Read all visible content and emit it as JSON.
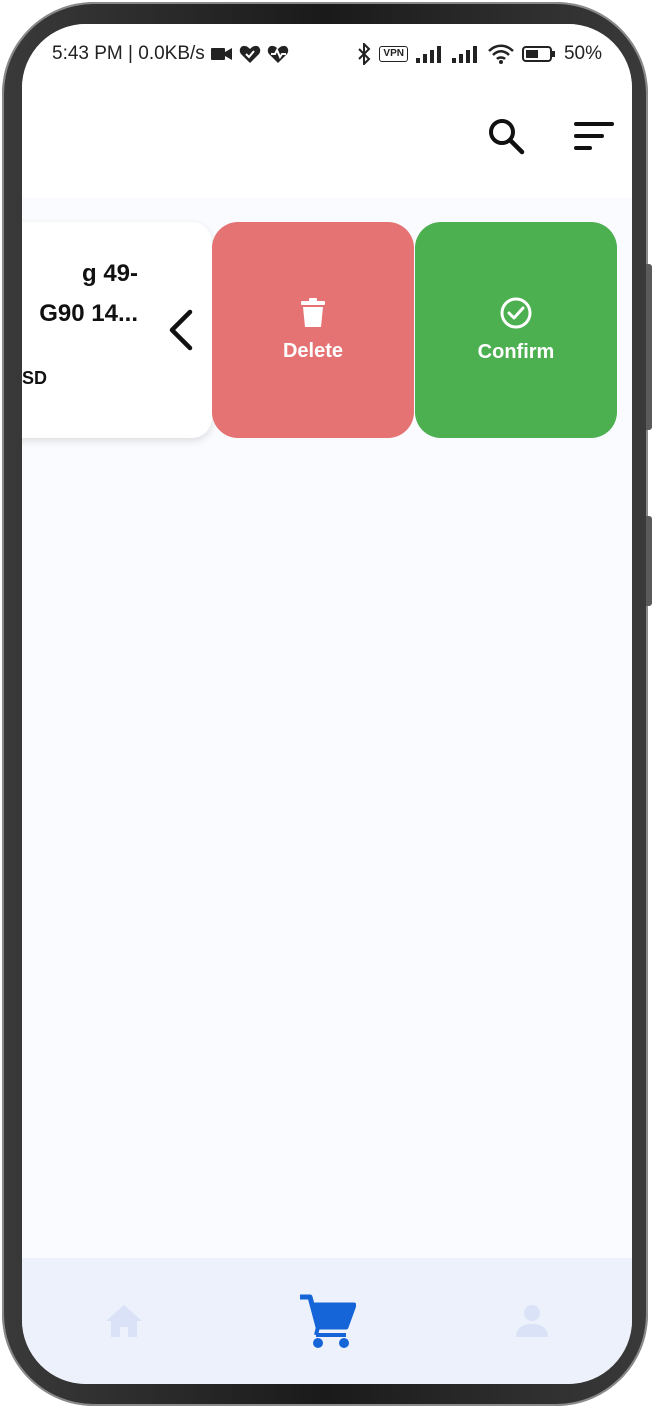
{
  "status_bar": {
    "time_speed": "5:43 PM | 0.0KB/s",
    "vpn": "VPN",
    "battery": "50%"
  },
  "app_bar": {
    "search_icon": "search-icon",
    "sort_icon": "sort-icon"
  },
  "card": {
    "title": "g 49-\nG90 14...",
    "subtitle": "SD"
  },
  "actions": {
    "delete_label": "Delete",
    "confirm_label": "Confirm"
  },
  "colors": {
    "delete": "#e57373",
    "confirm": "#4caf50",
    "nav_active": "#1565d8",
    "nav_inactive": "#d9e2f6"
  },
  "bottom_nav": {
    "items": [
      "home-icon",
      "cart-icon",
      "person-icon"
    ],
    "active": "cart-icon"
  }
}
